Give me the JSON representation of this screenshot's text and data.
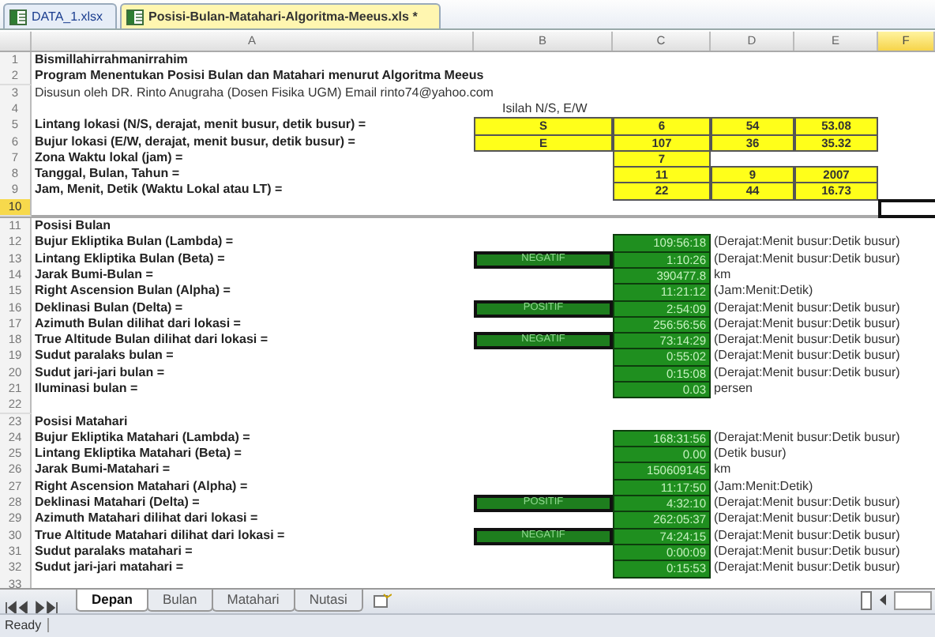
{
  "file_tabs": [
    {
      "label": "DATA_1.xlsx",
      "selected": false
    },
    {
      "label": "Posisi-Bulan-Matahari-Algoritma-Meeus.xls *",
      "selected": true
    }
  ],
  "columns": [
    {
      "label": "A",
      "selected": false
    },
    {
      "label": "B",
      "selected": false
    },
    {
      "label": "C",
      "selected": false
    },
    {
      "label": "D",
      "selected": false
    },
    {
      "label": "E",
      "selected": false
    },
    {
      "label": "F",
      "selected": true
    }
  ],
  "rows": [
    {
      "number": "1",
      "selected": false,
      "kind": "title",
      "label": "Bismillahirrahmanirrahim"
    },
    {
      "number": "2",
      "selected": false,
      "kind": "title",
      "label": "Program Menentukan Posisi Bulan dan Matahari menurut Algoritma Meeus"
    },
    {
      "number": "3",
      "selected": false,
      "kind": "note",
      "label": "Disusun oleh DR. Rinto Anugraha (Dosen Fisika UGM) Email rinto74@yahoo.com"
    },
    {
      "number": "4",
      "selected": false,
      "kind": "hint",
      "hint": "Isilah N/S, E/W"
    },
    {
      "number": "5",
      "selected": false,
      "kind": "input",
      "label": "Lintang lokasi (N/S, derajat, menit busur, detik busur) =",
      "sign": "S",
      "values": [
        "6",
        "54",
        "53.08"
      ]
    },
    {
      "number": "6",
      "selected": false,
      "kind": "input",
      "label": "Bujur lokasi (E/W, derajat, menit busur, detik busur) =",
      "sign": "E",
      "values": [
        "107",
        "36",
        "35.32"
      ]
    },
    {
      "number": "7",
      "selected": false,
      "kind": "input",
      "label": "Zona Waktu lokal (jam) =",
      "values": [
        "7"
      ]
    },
    {
      "number": "8",
      "selected": false,
      "kind": "input",
      "label": "Tanggal, Bulan, Tahun =",
      "values": [
        "11",
        "9",
        "2007"
      ]
    },
    {
      "number": "9",
      "selected": false,
      "kind": "input",
      "label": "Jam, Menit, Detik (Waktu Lokal atau LT) =",
      "values": [
        "22",
        "44",
        "16.73"
      ]
    },
    {
      "number": "10",
      "selected": true,
      "kind": "blank"
    },
    {
      "number": "11",
      "selected": false,
      "kind": "section",
      "label": "Posisi Bulan"
    },
    {
      "number": "12",
      "selected": false,
      "kind": "result",
      "label": "Bujur Ekliptika Bulan (Lambda) =",
      "value": "109:56:18",
      "unit": "(Derajat:Menit busur:Detik busur)"
    },
    {
      "number": "13",
      "selected": false,
      "kind": "result",
      "label": "Lintang Ekliptika Bulan (Beta) =",
      "sign": "NEGATIF",
      "value": "1:10:26",
      "unit": "(Derajat:Menit busur:Detik busur)"
    },
    {
      "number": "14",
      "selected": false,
      "kind": "result",
      "label": "Jarak Bumi-Bulan =",
      "value": "390477.8",
      "unit": "km"
    },
    {
      "number": "15",
      "selected": false,
      "kind": "result",
      "label": "Right Ascension Bulan (Alpha) =",
      "value": "11:21:12",
      "unit": "(Jam:Menit:Detik)"
    },
    {
      "number": "16",
      "selected": false,
      "kind": "result",
      "label": "Deklinasi Bulan (Delta) =",
      "sign": "POSITIF",
      "value": "2:54:09",
      "unit": "(Derajat:Menit busur:Detik busur)"
    },
    {
      "number": "17",
      "selected": false,
      "kind": "result",
      "label": "Azimuth Bulan dilihat dari lokasi =",
      "value": "256:56:56",
      "unit": "(Derajat:Menit busur:Detik busur)"
    },
    {
      "number": "18",
      "selected": false,
      "kind": "result",
      "label": "True Altitude Bulan dilihat dari lokasi =",
      "sign": "NEGATIF",
      "value": "73:14:29",
      "unit": "(Derajat:Menit busur:Detik busur)"
    },
    {
      "number": "19",
      "selected": false,
      "kind": "result",
      "label": "Sudut paralaks bulan =",
      "value": "0:55:02",
      "unit": "(Derajat:Menit busur:Detik busur)"
    },
    {
      "number": "20",
      "selected": false,
      "kind": "result",
      "label": "Sudut jari-jari bulan =",
      "value": "0:15:08",
      "unit": "(Derajat:Menit busur:Detik busur)"
    },
    {
      "number": "21",
      "selected": false,
      "kind": "result",
      "label": "Iluminasi bulan =",
      "value": "0.03",
      "unit": "persen"
    },
    {
      "number": "22",
      "selected": false,
      "kind": "blank"
    },
    {
      "number": "23",
      "selected": false,
      "kind": "section",
      "label": "Posisi Matahari"
    },
    {
      "number": "24",
      "selected": false,
      "kind": "result",
      "label": "Bujur Ekliptika Matahari (Lambda) =",
      "value": "168:31:56",
      "unit": "(Derajat:Menit busur:Detik busur)"
    },
    {
      "number": "25",
      "selected": false,
      "kind": "result",
      "label": "Lintang Ekliptika Matahari (Beta) =",
      "value": "0.00",
      "unit": "(Detik busur)"
    },
    {
      "number": "26",
      "selected": false,
      "kind": "result",
      "label": "Jarak Bumi-Matahari =",
      "value": "150609145",
      "unit": "km"
    },
    {
      "number": "27",
      "selected": false,
      "kind": "result",
      "label": "Right Ascension Matahari (Alpha) =",
      "value": "11:17:50",
      "unit": "(Jam:Menit:Detik)"
    },
    {
      "number": "28",
      "selected": false,
      "kind": "result",
      "label": "Deklinasi Matahari (Delta) =",
      "sign": "POSITIF",
      "value": "4:32:10",
      "unit": "(Derajat:Menit busur:Detik busur)"
    },
    {
      "number": "29",
      "selected": false,
      "kind": "result",
      "label": "Azimuth Matahari dilihat dari lokasi =",
      "value": "262:05:37",
      "unit": "(Derajat:Menit busur:Detik busur)"
    },
    {
      "number": "30",
      "selected": false,
      "kind": "result",
      "label": "True Altitude Matahari dilihat dari lokasi =",
      "sign": "NEGATIF",
      "value": "74:24:15",
      "unit": "(Derajat:Menit busur:Detik busur)"
    },
    {
      "number": "31",
      "selected": false,
      "kind": "result",
      "label": "Sudut paralaks matahari =",
      "value": "0:00:09",
      "unit": "(Derajat:Menit busur:Detik busur)"
    },
    {
      "number": "32",
      "selected": false,
      "kind": "result",
      "label": "Sudut jari-jari matahari =",
      "value": "0:15:53",
      "unit": "(Derajat:Menit busur:Detik busur)"
    },
    {
      "number": "33",
      "selected": false,
      "kind": "blank"
    }
  ],
  "sheet_tabs": [
    {
      "label": "Depan",
      "selected": true
    },
    {
      "label": "Bulan",
      "selected": false
    },
    {
      "label": "Matahari",
      "selected": false
    },
    {
      "label": "Nutasi",
      "selected": false
    }
  ],
  "status_bar": "Ready"
}
